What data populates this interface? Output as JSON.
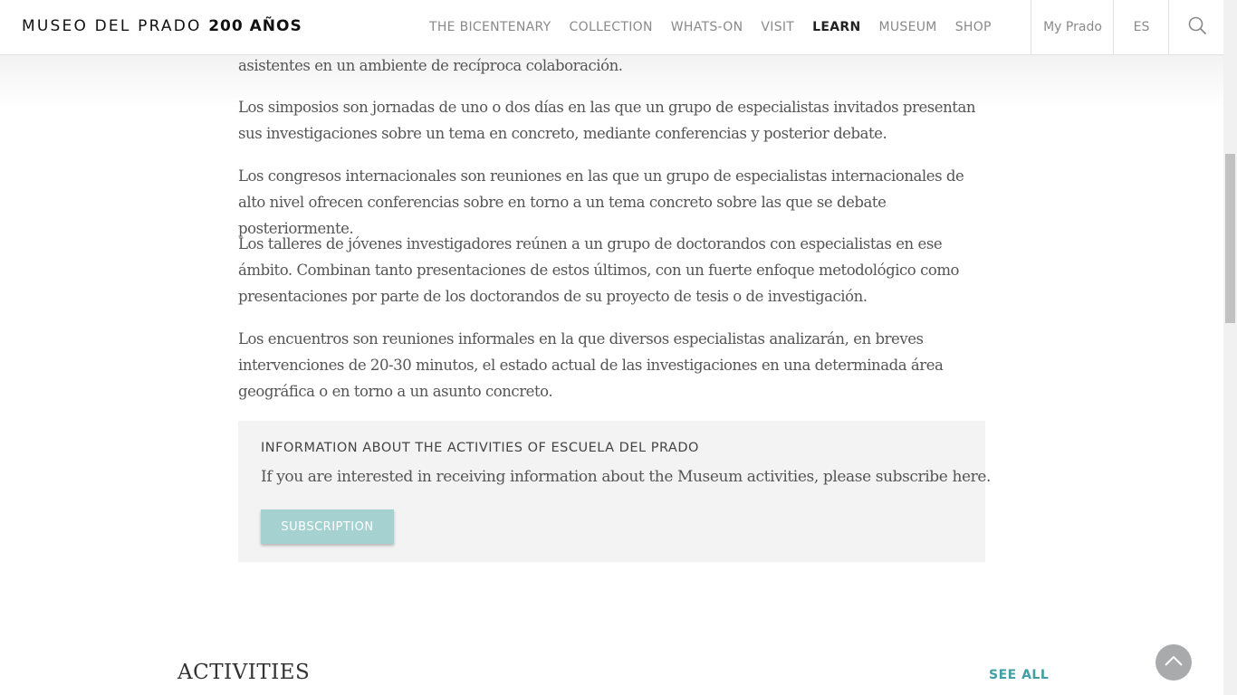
{
  "header": {
    "logo_text": "MUSEO DEL PRADO",
    "logo_bold": "200 AÑOS",
    "nav": [
      {
        "label": "THE BICENTENARY"
      },
      {
        "label": "COLLECTION"
      },
      {
        "label": "WHATS-ON"
      },
      {
        "label": "VISIT"
      },
      {
        "label": "LEARN"
      },
      {
        "label": "MUSEUM"
      },
      {
        "label": "SHOP"
      }
    ],
    "active_nav": "LEARN",
    "my_prado": "My Prado",
    "language": "ES",
    "search_icon": "search-icon"
  },
  "content": {
    "paragraphs": [
      "asistentes en un ambiente de recíproca colaboración.",
      "Los simposios son jornadas de uno o dos días en las que un grupo de especialistas invitados presentan sus investigaciones sobre un tema en concreto, mediante conferencias y posterior debate.",
      "Los congresos internacionales son reuniones en las que un grupo de especialistas internacionales de alto nivel ofrecen conferencias sobre en torno a un tema concreto sobre las que se debate posteriormente.",
      "Los talleres de jóvenes investigadores reúnen a un grupo de doctorandos con especialistas en ese ámbito. Combinan tanto presentaciones de estos últimos, con un fuerte enfoque metodológico como presentaciones por parte de los doctorandos de su proyecto de tesis o de investigación.",
      "Los encuentros son reuniones informales en la que diversos especialistas analizarán, en breves intervenciones de 20-30 minutos, el estado actual de las investigaciones en una determinada área geográfica o en torno a un asunto concreto."
    ]
  },
  "info_box": {
    "title": "INFORMATION ABOUT THE ACTIVITIES OF ESCUELA DEL PRADO",
    "text": "If you are interested in receiving information about the Museum activities, please subscribe here.",
    "button_label": "SUBSCRIPTION"
  },
  "activities": {
    "title": "ACTIVITIES",
    "see_all": "SEE ALL"
  },
  "colors": {
    "accent": "#3f9fa3",
    "button_bg": "#a5d1d1",
    "info_box_bg": "#f3f3f3",
    "to_top_bg": "#a8aaab"
  },
  "icons": {
    "to_top": "chevron-up-icon"
  }
}
